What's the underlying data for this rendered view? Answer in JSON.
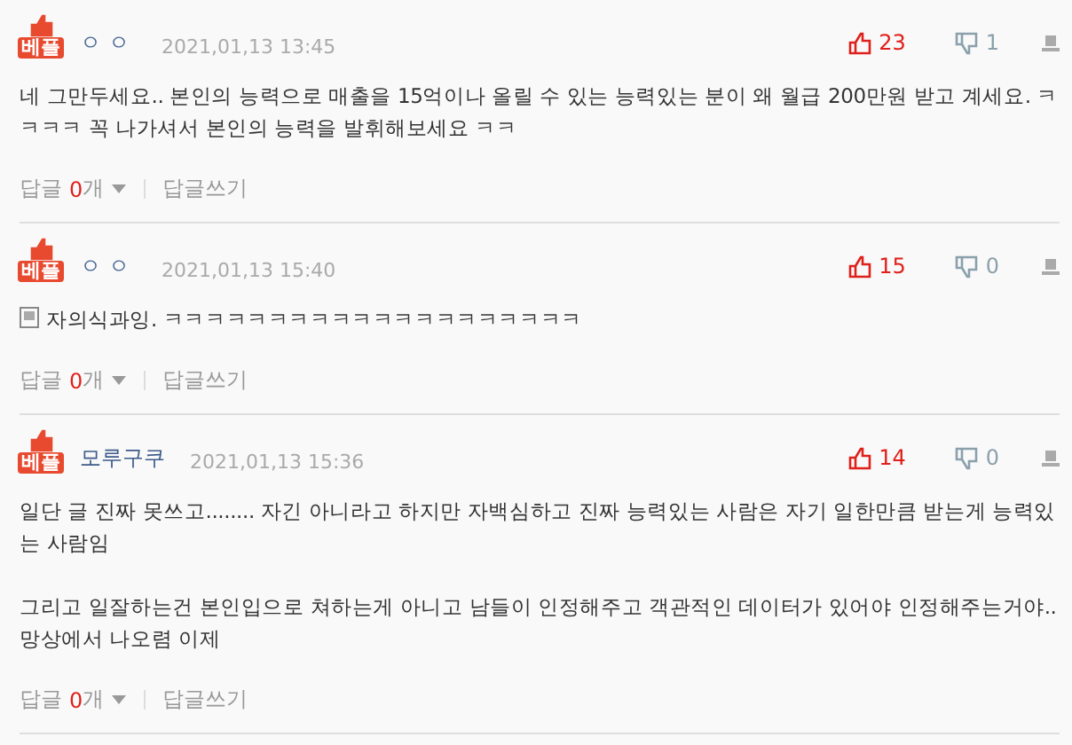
{
  "comments": [
    {
      "badge": "베플",
      "author": "ㅇㅇ",
      "author_link": false,
      "date": "2021,01,13 13:45",
      "likes": "23",
      "dislikes": "1",
      "memo_icon": false,
      "paragraphs": [
        "네 그만두세요.. 본인의 능력으로 매출을 15억이나 올릴 수 있는 능력있는 분이 왜 월급 200만원 받고 계세요. ㅋㅋㅋㅋ 꼭 나가셔서 본인의 능력을 발휘해보세요 ㅋㅋ"
      ],
      "reply_label": "답글",
      "reply_count": "0",
      "reply_unit": "개",
      "write_reply": "답글쓰기"
    },
    {
      "badge": "베플",
      "author": "ㅇㅇ",
      "author_link": false,
      "date": "2021,01,13 15:40",
      "likes": "15",
      "dislikes": "0",
      "memo_icon": true,
      "paragraphs": [
        "자의식과잉. ㅋㅋㅋㅋㅋㅋㅋㅋㅋㅋㅋㅋㅋㅋㅋㅋㅋㅋㅋㅋ"
      ],
      "reply_label": "답글",
      "reply_count": "0",
      "reply_unit": "개",
      "write_reply": "답글쓰기"
    },
    {
      "badge": "베플",
      "author": "모루구쿠",
      "author_link": true,
      "date": "2021,01,13 15:36",
      "likes": "14",
      "dislikes": "0",
      "memo_icon": false,
      "paragraphs": [
        "일단 글 진짜 못쓰고........ 자긴 아니라고 하지만 자백심하고 진짜 능력있는 사람은 자기 일한만큼 받는게 능력있는 사람임",
        "그리고 일잘하는건 본인입으로 쳐하는게 아니고 남들이 인정해주고 객관적인 데이터가 있어야 인정해주는거야.. 망상에서 나오렴 이제"
      ],
      "reply_label": "답글",
      "reply_count": "0",
      "reply_unit": "개",
      "write_reply": "답글쓰기"
    }
  ]
}
